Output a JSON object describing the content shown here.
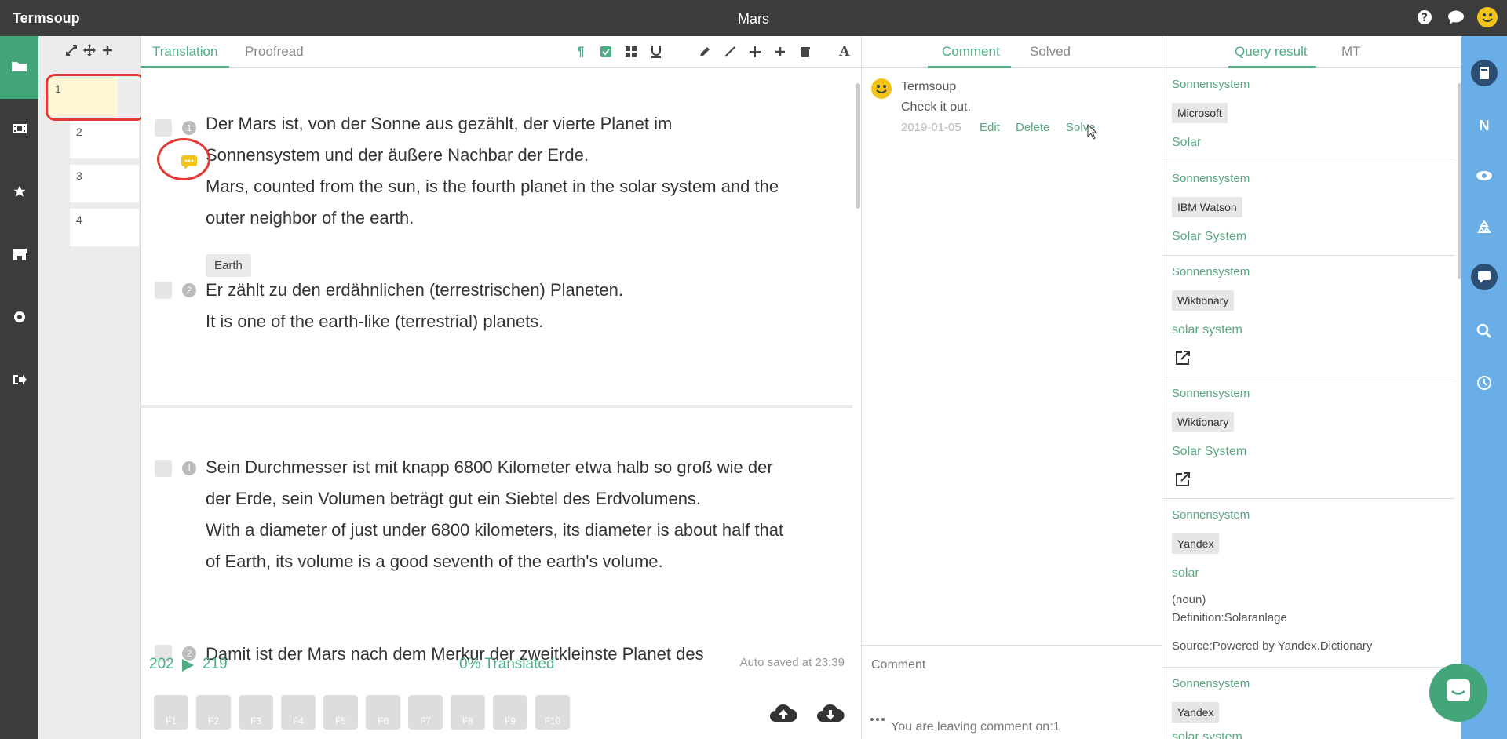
{
  "app": {
    "name": "Termsoup",
    "document_title": "Mars"
  },
  "top_icons": [
    "help-icon",
    "chat-icon",
    "user-avatar-icon"
  ],
  "left_nav": [
    "folder-icon",
    "film-icon",
    "star-icon",
    "store-icon",
    "settings-icon",
    "logout-icon"
  ],
  "segment_panel": {
    "segments": [
      "1",
      "2",
      "3",
      "4"
    ]
  },
  "editor": {
    "tabs": [
      "Translation",
      "Proofread"
    ],
    "units": [
      {
        "rows": [
          {
            "num": "1",
            "source": "Der Mars ist, von der Sonne aus gezählt, der vierte Planet im Sonnensystem und der äußere Nachbar der Erde.",
            "target": "Mars, counted from the sun, is the fourth planet in the solar system and the outer neighbor of the earth.",
            "tag": "Earth"
          },
          {
            "num": "2",
            "source": "Er zählt zu den erdähnlichen (terrestrischen) Planeten.",
            "target": "It is one of the earth-like (terrestrial) planets."
          }
        ]
      },
      {
        "rows": [
          {
            "num": "1",
            "source": "Sein Durchmesser ist mit knapp 6800 Kilometer etwa halb so groß wie der der Erde, sein Volumen beträgt gut ein Siebtel des Erdvolumens.",
            "target": "With a diameter of just under 6800 kilometers, its diameter is about half that of Earth, its volume is a good seventh of the earth's volume."
          },
          {
            "num": "2",
            "source": "Damit ist der Mars nach dem Merkur der zweitkleinste Planet des"
          }
        ]
      }
    ],
    "status": {
      "from": "202",
      "to": "219",
      "translated": "0% Translated",
      "autosave": "Auto saved at 23:39"
    },
    "fkeys": [
      "F1",
      "F2",
      "F3",
      "F4",
      "F5",
      "F6",
      "F7",
      "F8",
      "F9",
      "F10"
    ]
  },
  "comments": {
    "tabs": [
      "Comment",
      "Solved"
    ],
    "items": [
      {
        "author": "Termsoup",
        "text": "Check it out.",
        "date": "2019-01-05",
        "actions": [
          "Edit",
          "Delete",
          "Solve"
        ]
      }
    ],
    "input_placeholder": "Comment",
    "leaving_note": "You are leaving comment on:1"
  },
  "query": {
    "tabs": [
      "Query result",
      "MT"
    ],
    "items": [
      {
        "source": "Sonnensystem",
        "provider": "Microsoft",
        "target": "Solar"
      },
      {
        "source": "Sonnensystem",
        "provider": "IBM Watson",
        "target": "Solar System"
      },
      {
        "source": "Sonnensystem",
        "provider": "Wiktionary",
        "target": "solar system"
      },
      {
        "source": "Sonnensystem",
        "provider": "Wiktionary",
        "target": "Solar System"
      },
      {
        "source": "Sonnensystem",
        "provider": "Yandex",
        "target": "solar",
        "pos": "(noun)",
        "definition": "Definition:Solaranlage",
        "credit": "Source:Powered by Yandex.Dictionary"
      },
      {
        "source": "Sonnensystem",
        "provider": "Yandex",
        "target": "solar system"
      }
    ]
  },
  "right_rail": [
    "notebook-icon",
    "n-icon",
    "eye-icon",
    "recycle-icon",
    "comment-icon",
    "search-icon",
    "history-icon"
  ],
  "colors": {
    "accent": "#4caf84",
    "dark": "#3c3c3c",
    "rail": "#6aaee8",
    "highlight": "#e53935"
  }
}
